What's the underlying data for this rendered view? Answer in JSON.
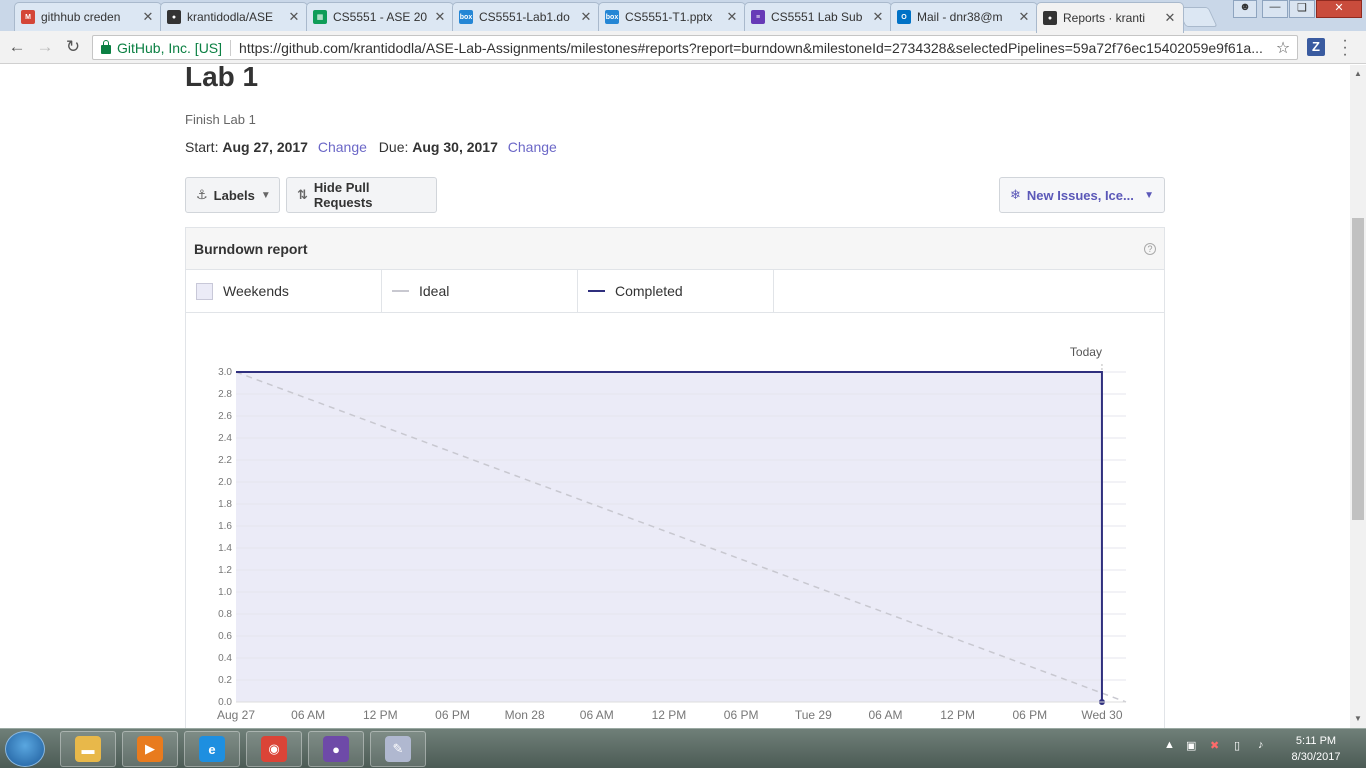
{
  "browser": {
    "tabs": [
      {
        "label": "githhub creden",
        "icon": "gmail-icon",
        "color": "#d44638",
        "glyph": "M"
      },
      {
        "label": "krantidodla/ASE",
        "icon": "github-icon",
        "color": "#333333",
        "glyph": "●"
      },
      {
        "label": "CS5551 - ASE 20",
        "icon": "sheets-icon",
        "color": "#0f9d58",
        "glyph": "▦"
      },
      {
        "label": "CS5551-Lab1.do",
        "icon": "box-icon",
        "color": "#2486d5",
        "glyph": "box"
      },
      {
        "label": "CS5551-T1.pptx",
        "icon": "box-icon",
        "color": "#2486d5",
        "glyph": "box"
      },
      {
        "label": "CS5551 Lab Sub",
        "icon": "forms-icon",
        "color": "#673ab7",
        "glyph": "≡"
      },
      {
        "label": "Mail - dnr38@m",
        "icon": "outlook-icon",
        "color": "#0072c6",
        "glyph": "O"
      },
      {
        "label": "Reports · kranti",
        "icon": "github-icon",
        "color": "#333333",
        "glyph": "●"
      }
    ],
    "site_identity": "GitHub, Inc. [US]",
    "url": "https://github.com/krantidodla/ASE-Lab-Assignments/milestones#reports?report=burndown&milestoneId=2734328&selectedPipelines=59a72f76ec15402059e9f61a...",
    "extension_label": "Z"
  },
  "milestone": {
    "title": "Lab 1",
    "description": "Finish Lab 1",
    "start_label": "Start:",
    "start_date": "Aug 27, 2017",
    "due_label": "Due:",
    "due_date": "Aug 30, 2017",
    "change_label": "Change"
  },
  "filters": {
    "labels_button": "Labels",
    "hide_prs_button": "Hide Pull Requests",
    "pipelines_button": "New Issues, Ice..."
  },
  "report": {
    "title": "Burndown report",
    "help": "?",
    "legend": [
      {
        "label": "Weekends",
        "kind": "box",
        "color": "#ebebf7"
      },
      {
        "label": "Ideal",
        "kind": "line",
        "color": "#c8c8d0"
      },
      {
        "label": "Completed",
        "kind": "line",
        "color": "#2f2f7e"
      }
    ]
  },
  "chart_data": {
    "type": "line",
    "title": "Burndown report",
    "xlabel": "",
    "ylabel": "",
    "ylim": [
      0,
      3.0
    ],
    "yticks": [
      "0.0",
      "0.2",
      "0.4",
      "0.6",
      "0.8",
      "1.0",
      "1.2",
      "1.4",
      "1.6",
      "1.8",
      "2.0",
      "2.2",
      "2.4",
      "2.6",
      "2.8",
      "3.0"
    ],
    "xticks": [
      "Aug 27",
      "06 AM",
      "12 PM",
      "06 PM",
      "Mon 28",
      "06 AM",
      "12 PM",
      "06 PM",
      "Tue 29",
      "06 AM",
      "12 PM",
      "06 PM",
      "Wed 30"
    ],
    "xticks_hours": [
      0,
      6,
      12,
      18,
      24,
      30,
      36,
      42,
      48,
      54,
      60,
      66,
      72
    ],
    "x_range_hours": [
      0,
      74
    ],
    "today_label": "Today",
    "today_hour": 72,
    "weekend_span_hours": [
      0,
      72
    ],
    "series": [
      {
        "name": "Ideal",
        "style": "dashed",
        "color": "#c8c8d0",
        "points": [
          [
            0,
            3.0
          ],
          [
            74,
            0.0
          ]
        ]
      },
      {
        "name": "Completed",
        "style": "solid",
        "color": "#2f2f7e",
        "points": [
          [
            0,
            3.0
          ],
          [
            72,
            3.0
          ],
          [
            72,
            0.0
          ]
        ]
      }
    ]
  },
  "taskbar": {
    "apps": [
      {
        "name": "explorer-icon",
        "color": "#e8b84a",
        "glyph": "▬"
      },
      {
        "name": "media-player-icon",
        "color": "#e87b1e",
        "glyph": "▶"
      },
      {
        "name": "internet-explorer-icon",
        "color": "#1e8fe0",
        "glyph": "e"
      },
      {
        "name": "chrome-icon",
        "color": "#db4437",
        "glyph": "◉"
      },
      {
        "name": "github-desktop-icon",
        "color": "#6e4aa8",
        "glyph": "●"
      },
      {
        "name": "paint-icon",
        "color": "#b0b8d0",
        "glyph": "✎"
      }
    ],
    "time": "5:11 PM",
    "date": "8/30/2017"
  }
}
